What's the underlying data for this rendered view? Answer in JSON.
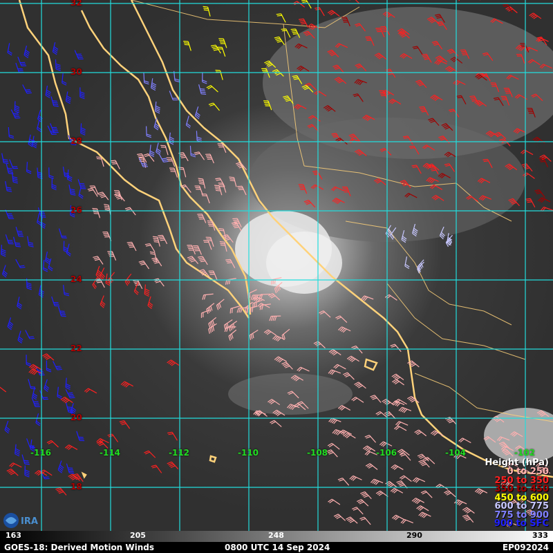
{
  "map": {
    "latitudes": [
      {
        "label": "32"
      },
      {
        "label": "30"
      },
      {
        "label": "28"
      },
      {
        "label": "26"
      },
      {
        "label": "24"
      },
      {
        "label": "22"
      },
      {
        "label": "20"
      },
      {
        "label": "18"
      }
    ],
    "longitudes": [
      {
        "label": "-116"
      },
      {
        "label": "-114"
      },
      {
        "label": "-112"
      },
      {
        "label": "-110"
      },
      {
        "label": "-108"
      },
      {
        "label": "-106"
      },
      {
        "label": "-104"
      },
      {
        "label": "-102"
      }
    ],
    "grid_color": "#22dddd",
    "coast_color": "#ffd27a"
  },
  "legend": {
    "title": "Height (hPa)",
    "entries": [
      {
        "label": "0 to 250",
        "color": "#ffb0b0"
      },
      {
        "label": "250 to 350",
        "color": "#ff2020"
      },
      {
        "label": "350 to 450",
        "color": "#a00000"
      },
      {
        "label": "450 to 600",
        "color": "#ffff00"
      },
      {
        "label": "600 to 775",
        "color": "#c8c8ff"
      },
      {
        "label": "775 to 900",
        "color": "#8080ff"
      },
      {
        "label": "900 to SFC",
        "color": "#2020ff"
      }
    ]
  },
  "colorbar": {
    "ticks": [
      "163",
      "205",
      "248",
      "290",
      "333"
    ]
  },
  "footer": {
    "left": "GOES-18: Derived Motion Winds",
    "center": "0800 UTC 14 Sep 2024",
    "right": "EP092024"
  },
  "logo": {
    "icon": "cira-logo-icon"
  }
}
